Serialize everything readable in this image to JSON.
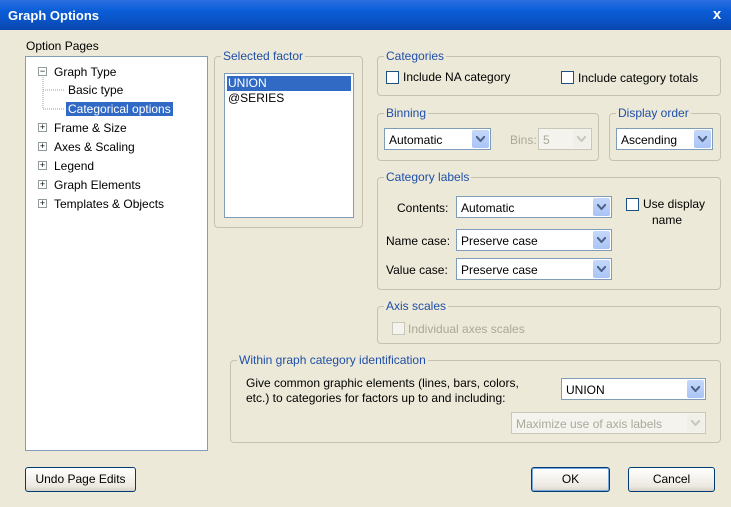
{
  "window": {
    "title": "Graph Options",
    "close_glyph": "x"
  },
  "option_pages": {
    "label": "Option Pages",
    "tree": [
      {
        "label": "Graph Type",
        "expander": "−"
      },
      {
        "label": "Basic type"
      },
      {
        "label": "Categorical options",
        "selected": true
      },
      {
        "label": "Frame & Size",
        "expander": "+"
      },
      {
        "label": "Axes & Scaling",
        "expander": "+"
      },
      {
        "label": "Legend",
        "expander": "+"
      },
      {
        "label": "Graph Elements",
        "expander": "+"
      },
      {
        "label": "Templates & Objects",
        "expander": "+"
      }
    ]
  },
  "selected_factor": {
    "title": "Selected factor",
    "items": [
      {
        "label": "UNION",
        "selected": true
      },
      {
        "label": "@SERIES"
      }
    ]
  },
  "categories": {
    "title": "Categories",
    "include_na": "Include NA category",
    "include_totals": "Include category totals"
  },
  "binning": {
    "title": "Binning",
    "mode": "Automatic",
    "bins_label": "Bins:",
    "bins_value": "5"
  },
  "display_order": {
    "title": "Display order",
    "value": "Ascending"
  },
  "category_labels": {
    "title": "Category labels",
    "contents_label": "Contents:",
    "contents_value": "Automatic",
    "name_case_label": "Name case:",
    "name_case_value": "Preserve case",
    "value_case_label": "Value case:",
    "value_case_value": "Preserve case",
    "use_display_name_line1": "Use display",
    "use_display_name_line2": "name"
  },
  "axis_scales": {
    "title": "Axis scales",
    "individual": "Individual axes scales"
  },
  "within_graph": {
    "title": "Within graph category identification",
    "desc_line1": "Give common graphic elements (lines, bars, colors,",
    "desc_line2": "etc.) to categories for factors up to and including:",
    "factor_value": "UNION",
    "axis_labels_value": "Maximize use of axis labels"
  },
  "buttons": {
    "undo": "Undo Page Edits",
    "ok": "OK",
    "cancel": "Cancel"
  },
  "colors": {
    "titlebar": "#0a52c4",
    "selection": "#316ac5",
    "group_title": "#1f4fa8",
    "dialog_bg": "#ece9d8"
  }
}
